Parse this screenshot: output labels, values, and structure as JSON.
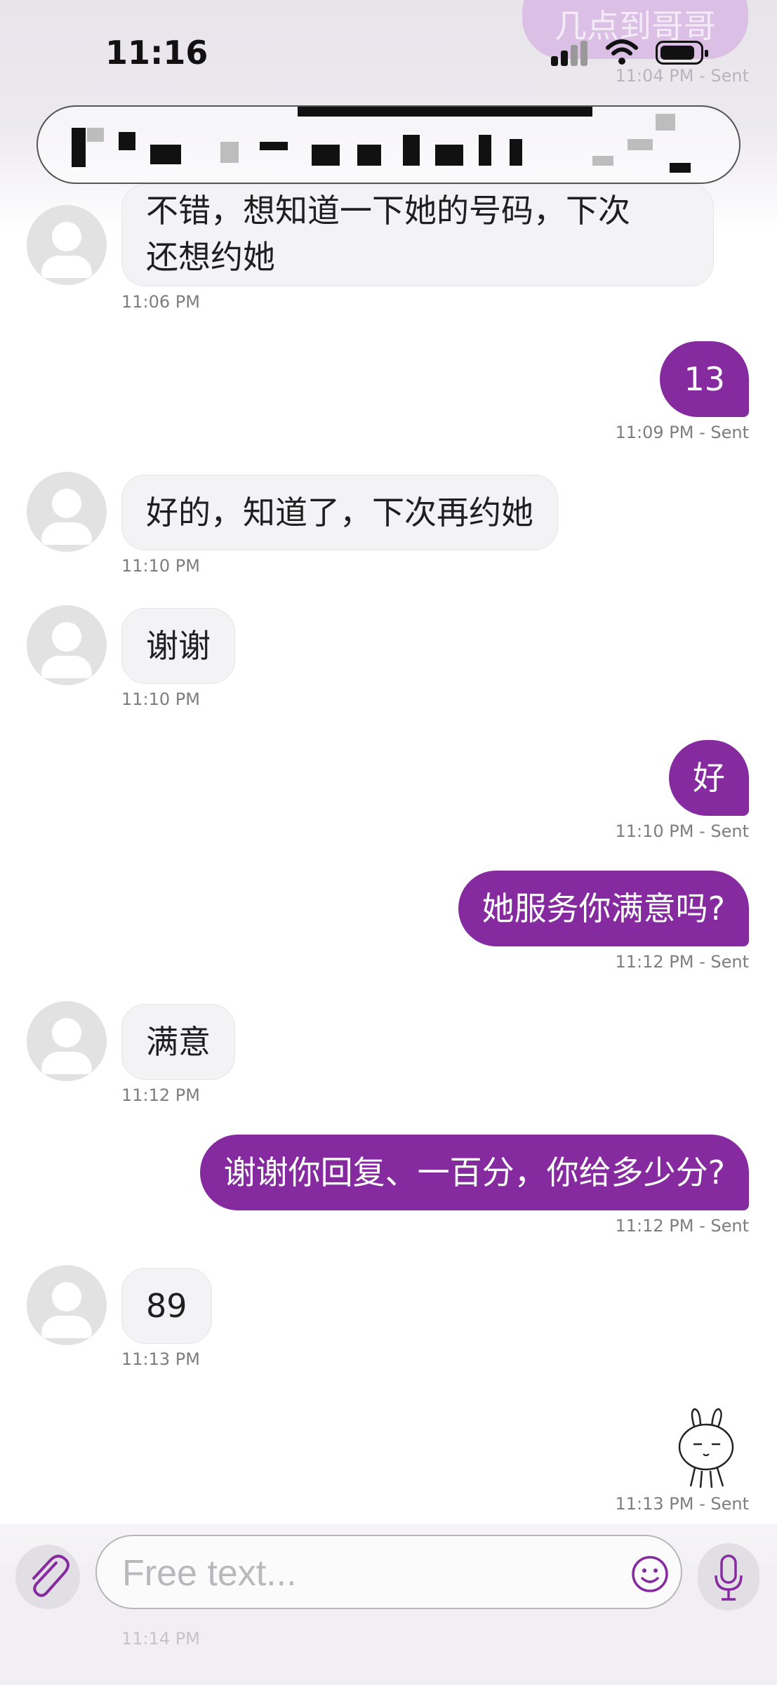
{
  "status_bar": {
    "time": "11:16"
  },
  "prior_message": {
    "text": "几点到哥哥",
    "meta": "11:04 PM - Sent"
  },
  "messages": [
    {
      "dir": "in",
      "text_lines": [
        "不错，想知道一下她的号码，下次",
        "还想约她"
      ],
      "meta": "11:06 PM"
    },
    {
      "dir": "out",
      "text": "13",
      "meta": "11:09 PM - Sent"
    },
    {
      "dir": "in",
      "text": "好的，知道了，下次再约她",
      "meta": "11:10 PM"
    },
    {
      "dir": "in",
      "text": "谢谢",
      "meta": "11:10 PM"
    },
    {
      "dir": "out",
      "text": "好",
      "meta": "11:10 PM - Sent"
    },
    {
      "dir": "out",
      "text": "她服务你满意吗?",
      "meta": "11:12 PM - Sent"
    },
    {
      "dir": "in",
      "text": "满意",
      "meta": "11:12 PM"
    },
    {
      "dir": "out",
      "text": "谢谢你回复、一百分，你给多少分?",
      "meta": "11:12 PM - Sent"
    },
    {
      "dir": "in",
      "text": "89",
      "meta": "11:13 PM"
    },
    {
      "dir": "out",
      "sticker": "rabbit-sticker",
      "meta": "11:13 PM - Sent"
    }
  ],
  "composer": {
    "placeholder": "Free text...",
    "ghost_meta": "11:14 PM"
  },
  "icons": [
    "paperclip-icon",
    "smiley-icon",
    "microphone-icon",
    "signal-icon",
    "wifi-icon",
    "battery-icon"
  ],
  "colors": {
    "accent": "#862a9f",
    "incoming_bubble": "#f3f3f5",
    "meta_text": "#7d7d82"
  }
}
